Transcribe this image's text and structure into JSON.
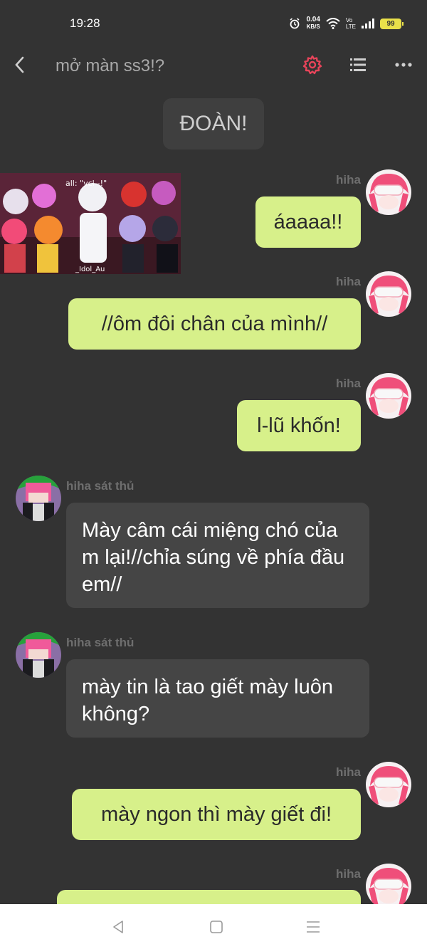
{
  "status": {
    "time": "19:28",
    "net_speed_value": "0.04",
    "net_speed_unit": "KB/S",
    "volte_top": "Vo",
    "volte_bottom": "LTE",
    "battery": "99"
  },
  "header": {
    "title": "mở màn ss3!?"
  },
  "messages": {
    "narration": "ĐOÀN!",
    "m1_name": "hiha",
    "m1_text": "áaaaa!!",
    "m2_name": "hiha",
    "m2_text": "//ôm đôi chân của mình//",
    "m3_name": "hiha",
    "m3_text": "l-lũ khốn!",
    "m4_name": "hiha sát thủ",
    "m4_text": "Mày câm cái miệng chó của m lại!//chỉa súng về phía đầu em//",
    "m5_name": "hiha sát thủ",
    "m5_text": "mày tin là tao giết mày luôn không?",
    "m6_name": "hiha",
    "m6_text": "mày ngon thì mày giết đi!",
    "m7_name": "hiha"
  },
  "art": {
    "caption_top": "all: \"vcl--!\"",
    "caption_bottom": "_Idol_Au"
  },
  "colors": {
    "background": "#333333",
    "bubble_right": "#d7f08a",
    "bubble_left": "#454545",
    "accent_gear": "#e8445a"
  },
  "icons": {
    "back": "chevron-left-icon",
    "settings": "gear-icon",
    "list": "list-icon",
    "more": "more-dots-icon"
  }
}
